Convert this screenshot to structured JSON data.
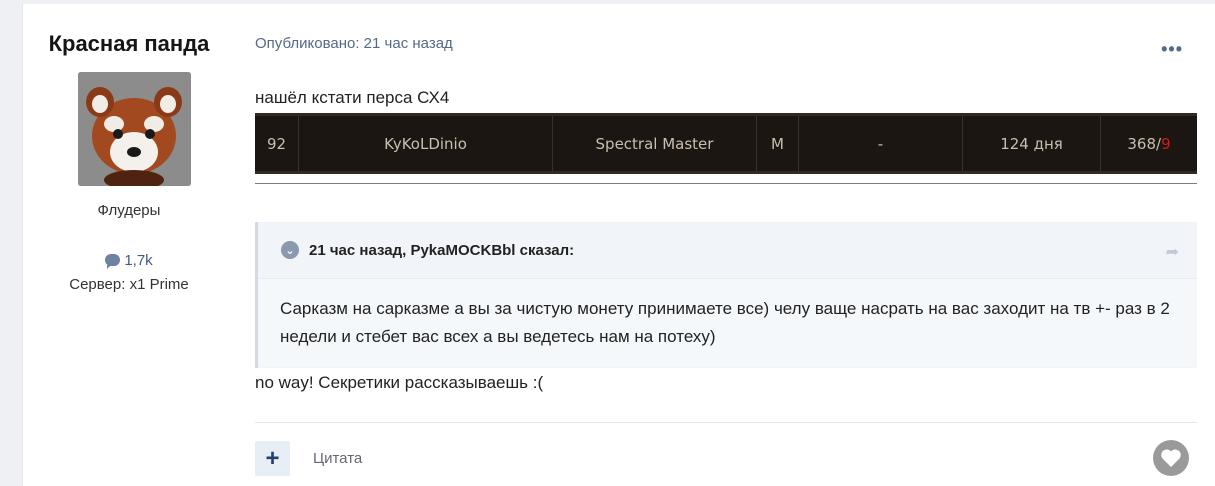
{
  "author": {
    "name": "Красная панда",
    "group": "Флудеры",
    "posts_count": "1,7k",
    "server": "Сервер: x1 Prime"
  },
  "post": {
    "meta": "Опубликовано: 21 час назад",
    "line1": "нашёл кстати перса СХ4",
    "rank_row": {
      "rank": "92",
      "nick": "KyKoLDinio",
      "class": "Spectral Master",
      "gender": "М",
      "clan": "-",
      "time": "124 дня",
      "score_main": "368/",
      "score_red": "9"
    },
    "quote": {
      "header": "21 час назад, PykaMOCKBbl сказал:",
      "body": "Сарказм на сарказме а вы за чистую монету принимаете все) челу ваще насрать на вас заходит на тв +- раз в 2 недели и стебет вас всех а вы ведетесь нам на потеху)"
    },
    "line2": "no way! Секретики рассказываешь :(",
    "plus_label": "+",
    "quote_label": "Цитата"
  },
  "icons": {
    "more": "ellipsis-icon",
    "toggle": "chevron-down-icon",
    "share": "share-arrow-icon",
    "comment": "comment-bubble-icon",
    "like": "heart-icon"
  },
  "colors": {
    "link": "#55698a",
    "table_bg": "#1c1612",
    "table_text": "#c9bfae",
    "accent_red": "#d11d1d"
  }
}
